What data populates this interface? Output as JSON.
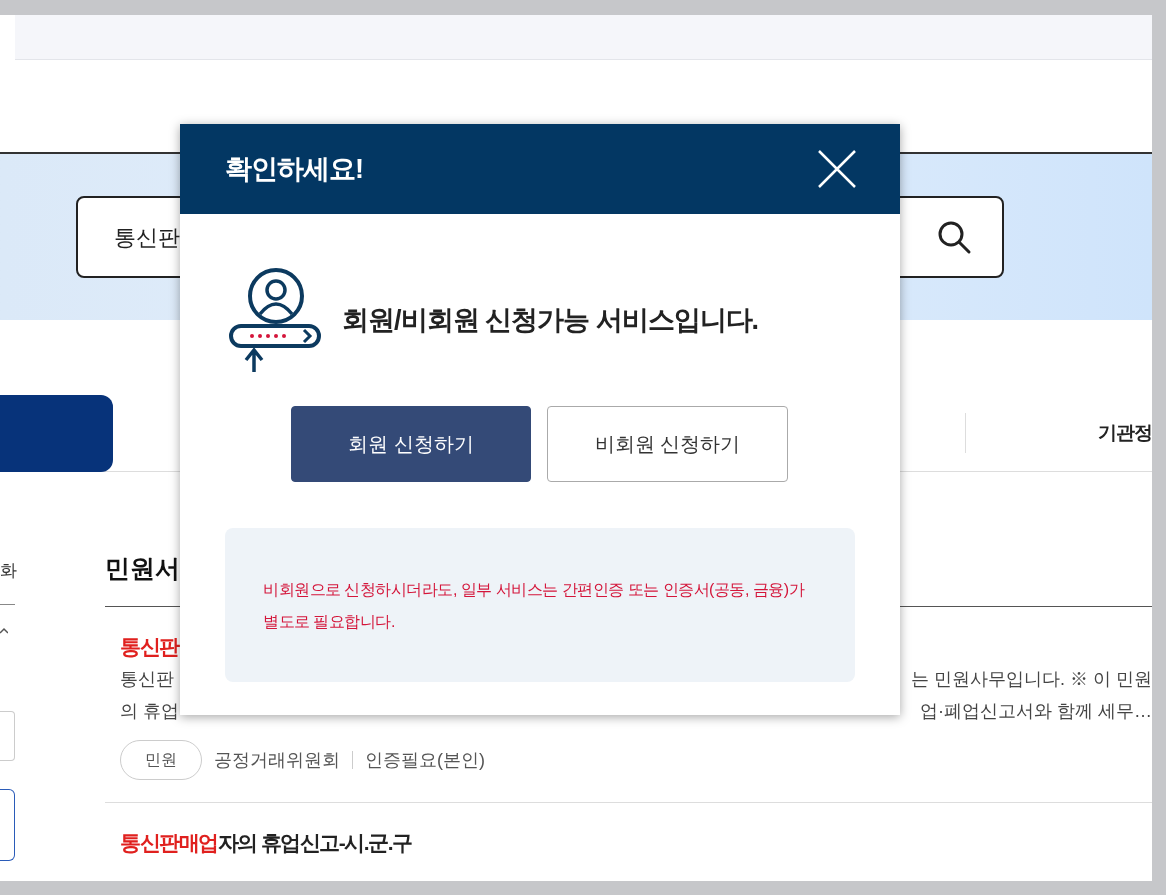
{
  "search": {
    "value": "통신판"
  },
  "tabs": [
    {
      "selected": true
    },
    {
      "label": "기관정",
      "selected": false
    }
  ],
  "sidebar": {
    "text": "화"
  },
  "results": {
    "heading": "민원서",
    "items": [
      {
        "title_highlight": "통신판",
        "description": [
          [
            "통신판",
            "는 민원사무입니다. ※ 이 민원"
          ],
          [
            "의 휴업",
            "업·폐업신고서와 함께 세무…"
          ]
        ],
        "badge": "민원",
        "agency": "공정거래위원회",
        "auth": "인증필요(본인)"
      },
      {
        "title_highlight": "통신판매업",
        "title_rest": "자의 휴업신고-시.군.구"
      }
    ]
  },
  "modal": {
    "title": "확인하세요!",
    "message": "회원/비회원 신청가능 서비스입니다.",
    "buttons": [
      {
        "label": "회원 신청하기",
        "kind": "primary"
      },
      {
        "label": "비회원 신청하기",
        "kind": "secondary"
      }
    ],
    "notice": "비회원으로 신청하시더라도, 일부 서비스는 간편인증 또는 인증서(공동, 금융)가 별도로 필요합니다."
  }
}
